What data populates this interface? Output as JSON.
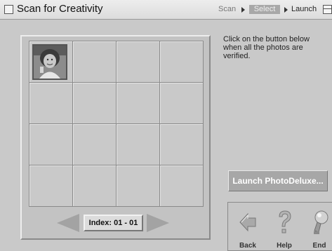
{
  "window": {
    "title": "Scan for Creativity"
  },
  "steps": {
    "scan": "Scan",
    "select": "Select",
    "launch": "Launch"
  },
  "instructions": "Click on the button below when all the photos are verified.",
  "index": {
    "label": "Index: 01 - 01"
  },
  "buttons": {
    "launch": "Launch PhotoDeluxe..."
  },
  "toolbar": {
    "back": "Back",
    "help": "Help",
    "end": "End"
  }
}
